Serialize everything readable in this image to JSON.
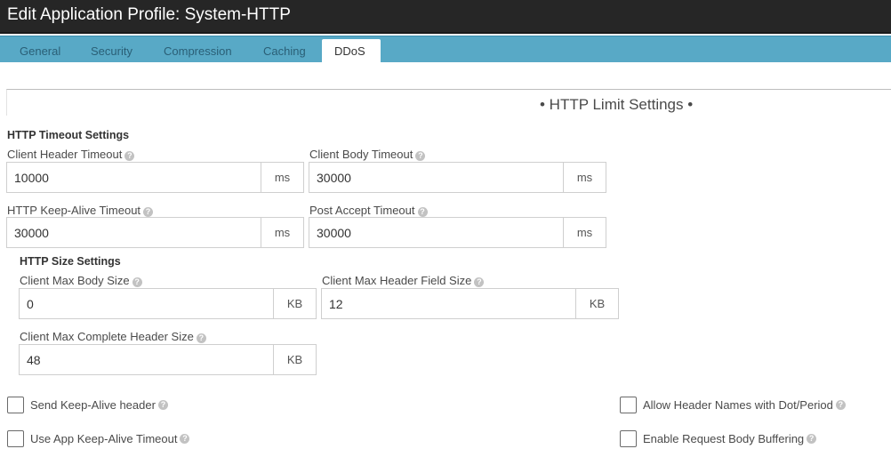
{
  "window": {
    "title": "Edit Application Profile: System-HTTP"
  },
  "tabs": [
    {
      "label": "General"
    },
    {
      "label": "Security"
    },
    {
      "label": "Compression"
    },
    {
      "label": "Caching"
    },
    {
      "label": "DDoS"
    }
  ],
  "active_tab": "DDoS",
  "section": {
    "heading": "• HTTP Limit Settings •"
  },
  "timeout": {
    "heading": "HTTP Timeout Settings",
    "client_header_timeout": {
      "label": "Client Header Timeout",
      "value": "10000",
      "unit": "ms"
    },
    "client_body_timeout": {
      "label": "Client Body Timeout",
      "value": "30000",
      "unit": "ms"
    },
    "keepalive_timeout": {
      "label": "HTTP Keep-Alive Timeout",
      "value": "30000",
      "unit": "ms"
    },
    "post_accept_timeout": {
      "label": "Post Accept Timeout",
      "value": "30000",
      "unit": "ms"
    }
  },
  "size": {
    "heading": "HTTP Size Settings",
    "client_max_body_size": {
      "label": "Client Max Body Size",
      "value": "0",
      "unit": "KB"
    },
    "client_max_header_field_size": {
      "label": "Client Max Header Field Size",
      "value": "12",
      "unit": "KB"
    },
    "client_max_complete_header_size": {
      "label": "Client Max Complete Header Size",
      "value": "48",
      "unit": "KB"
    }
  },
  "options": {
    "send_keepalive_header": {
      "label": "Send Keep-Alive header",
      "checked": false
    },
    "use_app_keepalive_timeout": {
      "label": "Use App Keep-Alive Timeout",
      "checked": false
    },
    "allow_header_names_dot": {
      "label": "Allow Header Names with Dot/Period",
      "checked": false
    },
    "enable_request_body_buffering": {
      "label": "Enable Request Body Buffering",
      "checked": false
    }
  },
  "icons": {
    "help": "question-circle-icon"
  },
  "colors": {
    "titlebar": "#262626",
    "tabbar": "#58a9c6",
    "active_tab": "#ffffff"
  }
}
